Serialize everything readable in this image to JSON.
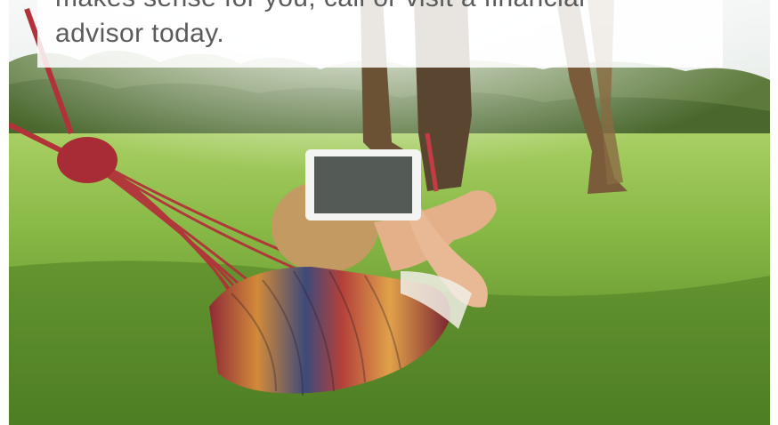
{
  "caption": {
    "text": "makes sense for you, call or visit a financial\nadvisor today.",
    "color": "#5b5b5b"
  },
  "photo": {
    "description_icon": "hammock-photo",
    "colors": {
      "sky": "#e9eef0",
      "grass_light": "#8fbf4a",
      "grass_dark": "#4f7f24",
      "tree_line": "#5d7a3c",
      "trunk": "#6b5235",
      "hammock_rope": "#b2323a",
      "hammock_stripe_a": "#8f2a36",
      "hammock_stripe_b": "#d28a3a",
      "hammock_stripe_c": "#3e4a7a",
      "hair": "#c49a63",
      "skin": "#e3b08a",
      "tablet": "#f4f4f2"
    }
  }
}
